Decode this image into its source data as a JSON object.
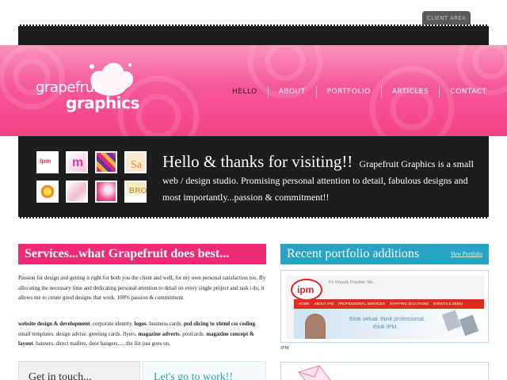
{
  "header": {
    "client_area_label": "CLIENT AREA",
    "logo_top": "grapefruit",
    "logo_bottom": "graphics"
  },
  "nav": {
    "items": [
      {
        "label": "HELLO"
      },
      {
        "label": "ABOUT"
      },
      {
        "label": "PORTFOLIO"
      },
      {
        "label": "ARTICLES"
      },
      {
        "label": "CONTACT"
      }
    ]
  },
  "hero": {
    "headline": "Hello & thanks for visiting!!",
    "body": "Grapefruit Graphics is a small web / design studio. Promising personal attention to detail, fabulous designs and most importantly...passion & commitment!!"
  },
  "services": {
    "title": "Services...what Grapefruit does best...",
    "intro": "Passion for design and getting it right for both you the client and well, for my own personal satisfaction too. By allocating the necessary time and dedicating personal attention to detail on every single project and task i do, it allows me to create good designs that work. 100% passion & commitment.",
    "list": [
      {
        "text": "website design & development",
        "bold": true
      },
      {
        "text": ". corporate identity. ",
        "bold": false
      },
      {
        "text": "logos",
        "bold": true
      },
      {
        "text": ". business cards. ",
        "bold": false
      },
      {
        "text": "psd slicing to xhtml css coding",
        "bold": true
      },
      {
        "text": ". email templates. design advise. greeting cards. flyers. ",
        "bold": false
      },
      {
        "text": "magazine adverts",
        "bold": true
      },
      {
        "text": ". postcards. ",
        "bold": false
      },
      {
        "text": "magazine concept & layout",
        "bold": true
      },
      {
        "text": ". banners. direct mailers. door hangers......the list just goes on.",
        "bold": false
      }
    ]
  },
  "portfolio": {
    "title": "Recent portfolio additions",
    "view_link": "View Portfolio",
    "caption": "IPM",
    "preview": {
      "logo": "ipm",
      "tagline": "It's Virtually Possible. We ...",
      "menu": [
        "HOME",
        "ABOUT IPM",
        "PROFESSIONAL SERVICES",
        "STAFFING SOLUTIONS",
        "EVENTS & DEMO"
      ],
      "slogan_1": "think virtual. think professional.",
      "slogan_2": "think IPM."
    }
  },
  "boxes": {
    "contact_title": "Get in touch...",
    "work_title": "Let's go to work!!"
  },
  "thumbnails": [
    {
      "label": "ipm"
    },
    {
      "label": "m"
    },
    {
      "label": ""
    },
    {
      "label": "Sa"
    },
    {
      "label": ""
    },
    {
      "label": ""
    },
    {
      "label": ""
    },
    {
      "label": "BRO"
    }
  ],
  "colors": {
    "pink": "#ee2a74",
    "cyan": "#27a4c4",
    "dark": "#1d1d1d"
  }
}
